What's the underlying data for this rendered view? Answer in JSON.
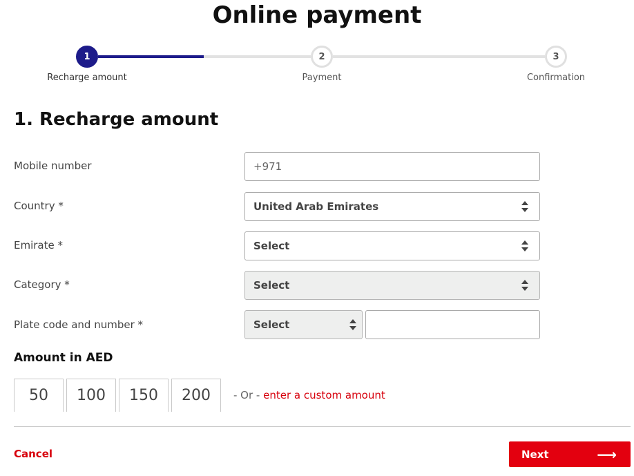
{
  "page": {
    "title": "Online payment"
  },
  "stepper": {
    "steps": [
      {
        "number": "1",
        "label": "Recharge amount"
      },
      {
        "number": "2",
        "label": "Payment"
      },
      {
        "number": "3",
        "label": "Confirmation"
      }
    ],
    "active_step": 1,
    "colors": {
      "active": "#1d1b8a",
      "inactive": "#e2e2e2"
    }
  },
  "form": {
    "section_title": "1. Recharge amount",
    "mobile": {
      "label": "Mobile number",
      "placeholder": "+971"
    },
    "country": {
      "label": "Country *",
      "value": "United Arab Emirates"
    },
    "emirate": {
      "label": "Emirate *",
      "value": "Select"
    },
    "category": {
      "label": "Category *",
      "value": "Select"
    },
    "plate": {
      "label": "Plate code and number *",
      "code_value": "Select",
      "number_value": ""
    }
  },
  "amount": {
    "title": "Amount in AED",
    "options": [
      "50",
      "100",
      "150",
      "200"
    ],
    "or_text": "- Or -",
    "custom_link": "enter a custom amount"
  },
  "actions": {
    "cancel_label": "Cancel",
    "next_label": "Next",
    "next_icon": "arrow-right-icon",
    "accent_color": "#e3000f"
  }
}
